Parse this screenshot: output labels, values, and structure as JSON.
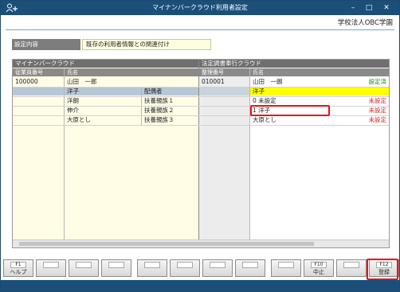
{
  "window": {
    "title": "マイナンバークラウド利用者設定",
    "company": "学校法人OBC学園"
  },
  "setting": {
    "label": "設定内容",
    "value": "既存の利用者情報との関連付け"
  },
  "grid": {
    "left_group": "マイナンバークラウド",
    "right_group": "法定調書奉行クラウド",
    "left_cols": [
      "従業員番号",
      "氏名"
    ],
    "right_cols": [
      "整理番号",
      "氏名"
    ],
    "rows": [
      {
        "emp_no": "100000",
        "name": "山田　一郎",
        "relation": "",
        "r_no": "010001",
        "r_name": "山田　一朗",
        "status": "設定済"
      },
      {
        "emp_no": "",
        "name": "洋子",
        "relation": "配偶者",
        "r_no": "",
        "r_name": "洋子",
        "status": ""
      },
      {
        "emp_no": "",
        "name": "洋朗",
        "relation": "扶養親族１",
        "r_no": "",
        "r_name": "0  未設定",
        "status": "未設定"
      },
      {
        "emp_no": "",
        "name": "伸介",
        "relation": "扶養親族２",
        "r_no": "",
        "r_name": "1  洋子",
        "status": "未設定"
      },
      {
        "emp_no": "",
        "name": "大原とし",
        "relation": "扶養親族３",
        "r_no": "",
        "r_name": "大原とし",
        "status": "未設定"
      }
    ]
  },
  "fkeys": [
    {
      "key": "F1",
      "label": "ヘルプ"
    },
    {
      "key": "",
      "label": ""
    },
    {
      "key": "",
      "label": ""
    },
    {
      "key": "",
      "label": ""
    },
    {
      "key": "",
      "label": ""
    },
    {
      "key": "",
      "label": ""
    },
    {
      "key": "",
      "label": ""
    },
    {
      "key": "",
      "label": ""
    },
    {
      "key": "",
      "label": ""
    },
    {
      "key": "F10",
      "label": "中止"
    },
    {
      "key": "",
      "label": ""
    },
    {
      "key": "F12",
      "label": "登録"
    }
  ],
  "colors": {
    "titlebar": "#1b4f7a",
    "selected_row": "#ffff00",
    "status_done": "#1a8a1a",
    "status_unset": "#e02020",
    "highlight": "#e11111"
  }
}
